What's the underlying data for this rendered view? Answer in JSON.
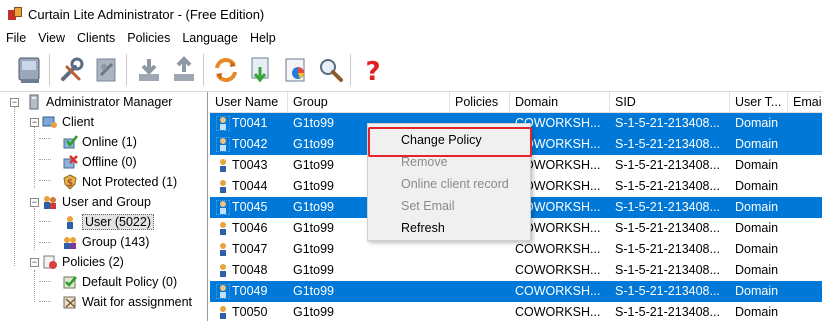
{
  "window": {
    "title": "Curtain Lite Administrator - (Free Edition)"
  },
  "menu": [
    "File",
    "View",
    "Clients",
    "Policies",
    "Language",
    "Help"
  ],
  "toolbar": {
    "icons": [
      "computer-icon",
      "tools-icon",
      "settings-icon",
      "download-icon",
      "upload-icon",
      "refresh-icon",
      "document-export-icon",
      "report-icon",
      "search-icon",
      "help-icon"
    ]
  },
  "tree": {
    "root": "Administrator Manager",
    "client": "Client",
    "online": "Online (1)",
    "offline": "Offline (0)",
    "not_protected": "Not Protected (1)",
    "user_group": "User and Group",
    "user": "User (5022)",
    "group": "Group (143)",
    "policies": "Policies (2)",
    "default_policy": "Default Policy (0)",
    "wait_assignment": "Wait for assignment"
  },
  "columns": [
    "User Name",
    "Group",
    "Policies",
    "Domain",
    "SID",
    "User T...",
    "Emai"
  ],
  "rows": [
    {
      "user": "T0041",
      "group": "G1to99",
      "policies": "",
      "domain": "COWORKSH...",
      "sid": "S-1-5-21-213408...",
      "type": "Domain",
      "selected": true
    },
    {
      "user": "T0042",
      "group": "G1to99",
      "policies": "",
      "domain": "COWORKSH...",
      "sid": "S-1-5-21-213408...",
      "type": "Domain",
      "selected": true
    },
    {
      "user": "T0043",
      "group": "G1to99",
      "policies": "",
      "domain": "COWORKSH...",
      "sid": "S-1-5-21-213408...",
      "type": "Domain",
      "selected": false
    },
    {
      "user": "T0044",
      "group": "G1to99",
      "policies": "",
      "domain": "COWORKSH...",
      "sid": "S-1-5-21-213408...",
      "type": "Domain",
      "selected": false
    },
    {
      "user": "T0045",
      "group": "G1to99",
      "policies": "",
      "domain": "COWORKSH...",
      "sid": "S-1-5-21-213408...",
      "type": "Domain",
      "selected": true
    },
    {
      "user": "T0046",
      "group": "G1to99",
      "policies": "",
      "domain": "COWORKSH...",
      "sid": "S-1-5-21-213408...",
      "type": "Domain",
      "selected": false
    },
    {
      "user": "T0047",
      "group": "G1to99",
      "policies": "",
      "domain": "COWORKSH...",
      "sid": "S-1-5-21-213408...",
      "type": "Domain",
      "selected": false
    },
    {
      "user": "T0048",
      "group": "G1to99",
      "policies": "",
      "domain": "COWORKSH...",
      "sid": "S-1-5-21-213408...",
      "type": "Domain",
      "selected": false
    },
    {
      "user": "T0049",
      "group": "G1to99",
      "policies": "",
      "domain": "COWORKSH...",
      "sid": "S-1-5-21-213408...",
      "type": "Domain",
      "selected": true
    },
    {
      "user": "T0050",
      "group": "G1to99",
      "policies": "",
      "domain": "COWORKSH...",
      "sid": "S-1-5-21-213408...",
      "type": "Domain",
      "selected": false
    }
  ],
  "context_menu": {
    "change_policy": "Change Policy",
    "remove": "Remove",
    "online_record": "Online client record",
    "set_email": "Set Email",
    "refresh": "Refresh"
  },
  "colors": {
    "selection": "#0078d7",
    "highlight": "#e3242b"
  }
}
